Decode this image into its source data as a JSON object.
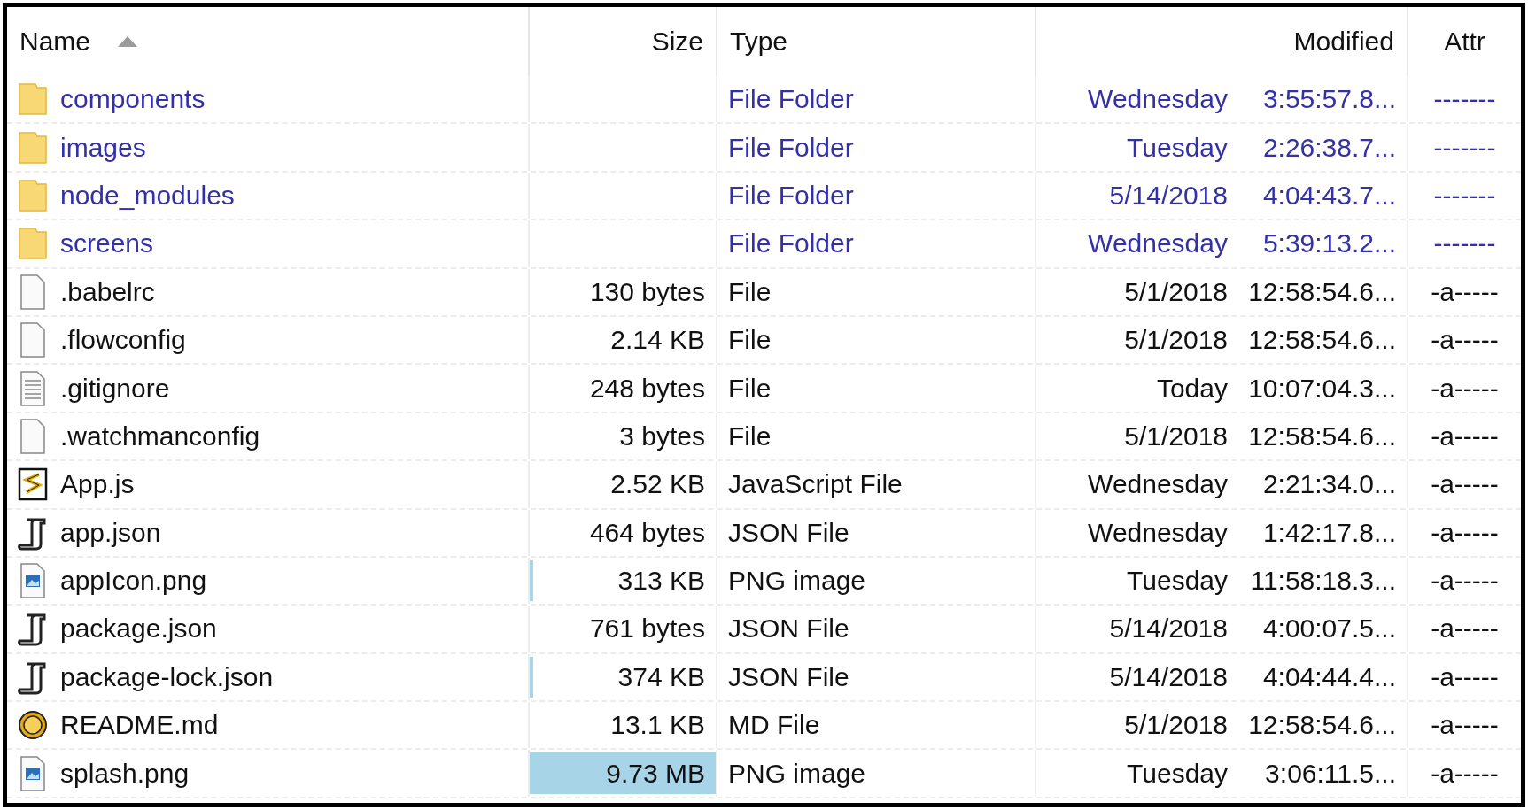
{
  "columns": [
    {
      "label": "Name",
      "sorted": true
    },
    {
      "label": "Size"
    },
    {
      "label": "Type"
    },
    {
      "label": "Modified"
    },
    {
      "label": "Attr"
    }
  ],
  "rows": [
    {
      "kind": "folder",
      "name": "components",
      "size": "",
      "type": "File Folder",
      "date": "Wednesday",
      "time": "3:55:57.8...",
      "attr": "-------"
    },
    {
      "kind": "folder",
      "name": "images",
      "size": "",
      "type": "File Folder",
      "date": "Tuesday",
      "time": "2:26:38.7...",
      "attr": "-------"
    },
    {
      "kind": "folder",
      "name": "node_modules",
      "size": "",
      "type": "File Folder",
      "date": "5/14/2018",
      "time": "4:04:43.7...",
      "attr": "-------"
    },
    {
      "kind": "folder",
      "name": "screens",
      "size": "",
      "type": "File Folder",
      "date": "Wednesday",
      "time": "5:39:13.2...",
      "attr": "-------"
    },
    {
      "kind": "file",
      "name": ".babelrc",
      "size": "130 bytes",
      "type": "File",
      "date": "5/1/2018",
      "time": "12:58:54.6...",
      "attr": "-a-----"
    },
    {
      "kind": "file",
      "name": ".flowconfig",
      "size": "2.14 KB",
      "type": "File",
      "date": "5/1/2018",
      "time": "12:58:54.6...",
      "attr": "-a-----"
    },
    {
      "kind": "text",
      "name": ".gitignore",
      "size": "248 bytes",
      "type": "File",
      "date": "Today",
      "time": "10:07:04.3...",
      "attr": "-a-----"
    },
    {
      "kind": "file",
      "name": ".watchmanconfig",
      "size": "3 bytes",
      "type": "File",
      "date": "5/1/2018",
      "time": "12:58:54.6...",
      "attr": "-a-----"
    },
    {
      "kind": "script",
      "name": "App.js",
      "size": "2.52 KB",
      "type": "JavaScript File",
      "date": "Wednesday",
      "time": "2:21:34.0...",
      "attr": "-a-----"
    },
    {
      "kind": "json",
      "name": "app.json",
      "size": "464 bytes",
      "type": "JSON File",
      "date": "Wednesday",
      "time": "1:42:17.8...",
      "attr": "-a-----"
    },
    {
      "kind": "image",
      "name": "appIcon.png",
      "size": "313 KB",
      "level": 0.02,
      "type": "PNG image",
      "date": "Tuesday",
      "time": "11:58:18.3...",
      "attr": "-a-----"
    },
    {
      "kind": "json",
      "name": "package.json",
      "size": "761 bytes",
      "type": "JSON File",
      "date": "5/14/2018",
      "time": "4:00:07.5...",
      "attr": "-a-----"
    },
    {
      "kind": "json",
      "name": "package-lock.json",
      "size": "374 KB",
      "level": 0.02,
      "type": "JSON File",
      "date": "5/14/2018",
      "time": "4:04:44.4...",
      "attr": "-a-----"
    },
    {
      "kind": "editor",
      "name": "README.md",
      "size": "13.1 KB",
      "type": "MD File",
      "date": "5/1/2018",
      "time": "12:58:54.6...",
      "attr": "-a-----"
    },
    {
      "kind": "image",
      "name": "splash.png",
      "size": "9.73 MB",
      "level": 1,
      "type": "PNG image",
      "date": "Tuesday",
      "time": "3:06:11.5...",
      "attr": "-a-----"
    }
  ]
}
